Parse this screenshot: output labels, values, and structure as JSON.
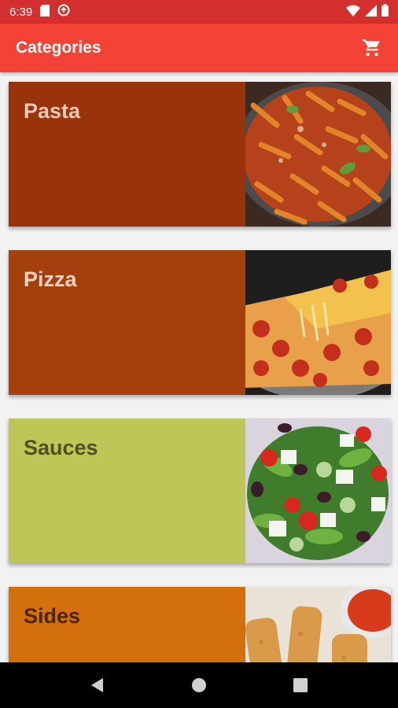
{
  "status_bar": {
    "time": "6:39",
    "icons": [
      "sd-card-icon",
      "sync-icon",
      "wifi-icon",
      "signal-icon",
      "battery-icon"
    ]
  },
  "app_bar": {
    "title": "Categories",
    "cart_icon": "cart-icon"
  },
  "categories": [
    {
      "label": "Pasta",
      "bg": "#98330c",
      "text_color": "#f0c8b8"
    },
    {
      "label": "Pizza",
      "bg": "#a3400e",
      "text_color": "#f4d2c2"
    },
    {
      "label": "Sauces",
      "bg": "#bdc657",
      "text_color": "#4f5220"
    },
    {
      "label": "Sides",
      "bg": "#d3700b",
      "text_color": "#4a2506"
    }
  ],
  "nav_bar": {
    "icons": [
      "back-icon",
      "home-icon",
      "recents-icon"
    ]
  },
  "colors": {
    "status_bar": "#d32f2f",
    "app_bar": "#f44336",
    "background": "#f2f2f2"
  }
}
